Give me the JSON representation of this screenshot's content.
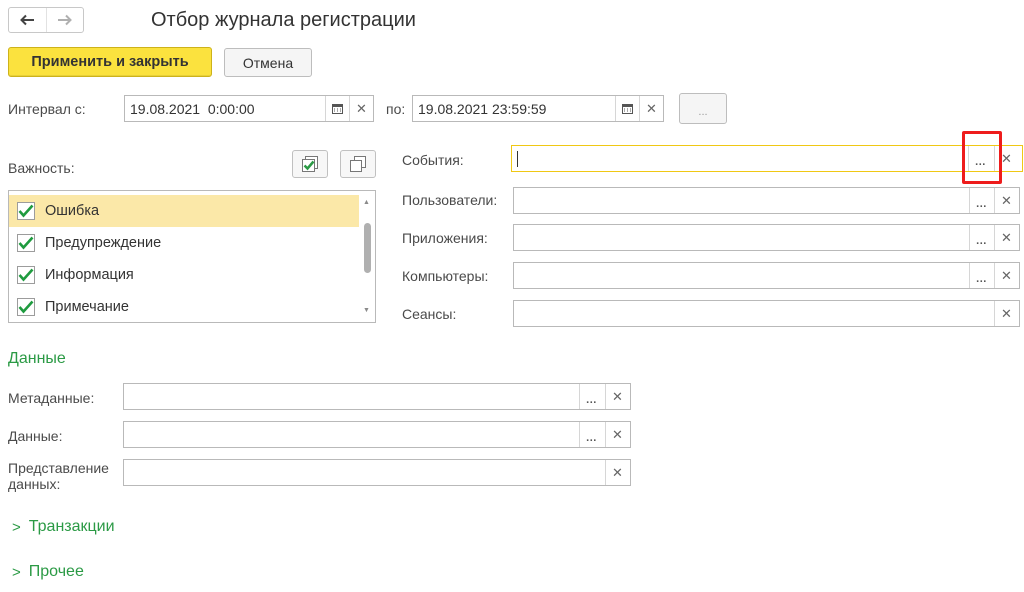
{
  "header": {
    "back_icon": "arrow-left-icon",
    "forward_icon": "arrow-right-icon",
    "title": "Отбор журнала регистрации"
  },
  "toolbar": {
    "apply_label": "Применить и закрыть",
    "cancel_label": "Отмена"
  },
  "interval": {
    "from_label": "Интервал с:",
    "from_value": "19.08.2021  0:00:00",
    "to_label": "по:",
    "to_value": "19.08.2021 23:59:59",
    "period_button": "..."
  },
  "importance": {
    "label": "Важность:",
    "items": [
      {
        "label": "Ошибка",
        "checked": true,
        "selected": true
      },
      {
        "label": "Предупреждение",
        "checked": true,
        "selected": false
      },
      {
        "label": "Информация",
        "checked": true,
        "selected": false
      },
      {
        "label": "Примечание",
        "checked": true,
        "selected": false
      }
    ]
  },
  "filters": {
    "events_label": "События:",
    "events_value": "",
    "users_label": "Пользователи:",
    "users_value": "",
    "apps_label": "Приложения:",
    "apps_value": "",
    "computers_label": "Компьютеры:",
    "computers_value": "",
    "sessions_label": "Сеансы:",
    "sessions_value": ""
  },
  "data_section": {
    "title": "Данные",
    "metadata_label": "Метаданные:",
    "data_label": "Данные:",
    "presentation_label_line1": "Представление",
    "presentation_label_line2": "данных:"
  },
  "collapsed": {
    "transactions": "Транзакции",
    "other": "Прочее"
  },
  "colors": {
    "accent_yellow": "#fbe23e",
    "section_green": "#2b9a45",
    "highlight_red": "#ee1c1c",
    "selected_row": "#fbe8a8"
  }
}
